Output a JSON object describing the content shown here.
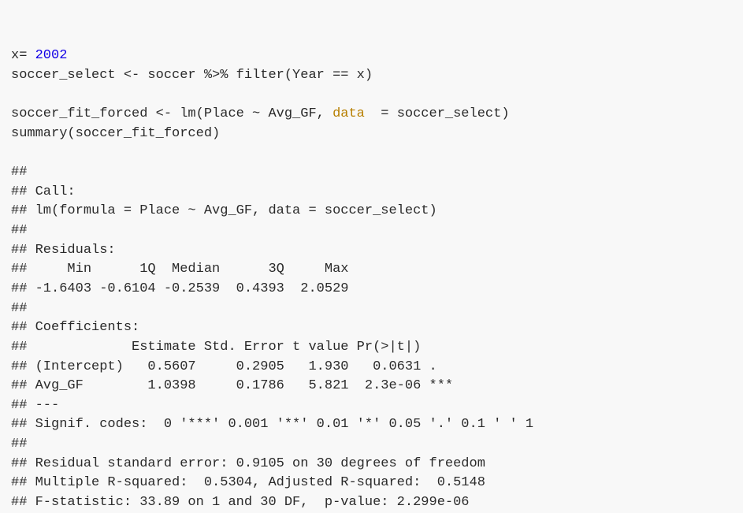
{
  "code": {
    "l1_a": "x= ",
    "l1_b": "2002",
    "l2": "soccer_select <- soccer %>% filter(Year == x)",
    "l3": "",
    "l4_a": "soccer_fit_forced <- lm(Place ~ Avg_GF, ",
    "l4_b": "data",
    "l4_c": "  = soccer_select)",
    "l5": "summary(soccer_fit_forced)"
  },
  "out": {
    "l01": "## ",
    "l02": "## Call:",
    "l03": "## lm(formula = Place ~ Avg_GF, data = soccer_select)",
    "l04": "## ",
    "l05": "## Residuals:",
    "l06": "##     Min      1Q  Median      3Q     Max ",
    "l07": "## -1.6403 -0.6104 -0.2539  0.4393  2.0529 ",
    "l08": "## ",
    "l09": "## Coefficients:",
    "l10": "##             Estimate Std. Error t value Pr(>|t|)    ",
    "l11": "## (Intercept)   0.5607     0.2905   1.930   0.0631 .  ",
    "l12": "## Avg_GF        1.0398     0.1786   5.821  2.3e-06 ***",
    "l13": "## ---",
    "l14": "## Signif. codes:  0 '***' 0.001 '**' 0.01 '*' 0.05 '.' 0.1 ' ' 1",
    "l15": "## ",
    "l16": "## Residual standard error: 0.9105 on 30 degrees of freedom",
    "l17": "## Multiple R-squared:  0.5304, Adjusted R-squared:  0.5148 ",
    "l18": "## F-statistic: 33.89 on 1 and 30 DF,  p-value: 2.299e-06"
  },
  "chart_data": {
    "type": "table",
    "title": "lm(Place ~ Avg_GF) summary, Year == 2002",
    "residuals": {
      "Min": -1.6403,
      "1Q": -0.6104,
      "Median": -0.2539,
      "3Q": 0.4393,
      "Max": 2.0529
    },
    "coefficients": [
      {
        "term": "(Intercept)",
        "Estimate": 0.5607,
        "StdError": 0.2905,
        "tValue": 1.93,
        "PrGtAbsT": 0.0631,
        "signif": "."
      },
      {
        "term": "Avg_GF",
        "Estimate": 1.0398,
        "StdError": 0.1786,
        "tValue": 5.821,
        "PrGtAbsT": 2.3e-06,
        "signif": "***"
      }
    ],
    "signif_codes": "0 '***' 0.001 '**' 0.01 '*' 0.05 '.' 0.1 ' ' 1",
    "residual_std_error": 0.9105,
    "df": 30,
    "r_squared": 0.5304,
    "adj_r_squared": 0.5148,
    "f_statistic": 33.89,
    "f_df": [
      1,
      30
    ],
    "p_value": 2.299e-06
  }
}
